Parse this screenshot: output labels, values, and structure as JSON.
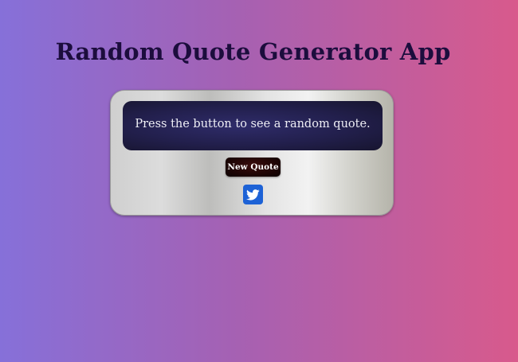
{
  "header": {
    "title": "Random Quote Generator App"
  },
  "quote_card": {
    "quote_text": "Press the button to see a random quote.",
    "new_quote_label": "New Quote",
    "share_icon": "twitter-icon"
  },
  "colors": {
    "background_left": "#8670d9",
    "background_right": "#d85a8c",
    "title_color": "#1c0d3d",
    "quote_box": "#221f4c",
    "button_color": "#1e0505",
    "twitter_blue": "#1d62d6"
  }
}
